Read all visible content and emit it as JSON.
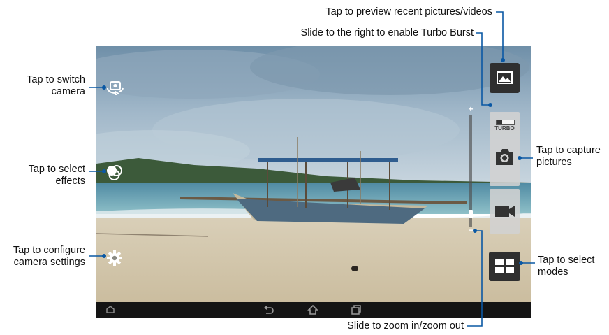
{
  "callouts": {
    "preview": "Tap to preview recent pictures/videos",
    "turbo": "Slide to the right to enable Turbo Burst",
    "switch_camera_1": "Tap to switch",
    "switch_camera_2": "camera",
    "effects_1": "Tap to select",
    "effects_2": "effects",
    "settings_1": "Tap to configure",
    "settings_2": "camera settings",
    "capture_1": "Tap to capture",
    "capture_2": "pictures",
    "modes_1": "Tap to select",
    "modes_2": "modes",
    "zoom": "Slide to zoom in/zoom out"
  },
  "camera_ui": {
    "turbo_label": "TURBO",
    "zoom_plus": "+",
    "zoom_minus": "−",
    "zoom_level": 0.08,
    "turbo_enabled": false
  },
  "icons": {
    "preview": "gallery-thumbnail-icon",
    "switch": "switch-camera-icon",
    "effects": "effects-icon",
    "settings": "gear-icon",
    "capture": "camera-shutter-icon",
    "video": "video-record-icon",
    "modes": "modes-grid-icon",
    "nav_home": "home-icon",
    "nav_back": "back-icon",
    "nav_recent": "recent-apps-icon"
  },
  "colors": {
    "callout_line": "#0a58a4",
    "button_dark": "#2f2f2f",
    "button_light": "#d2d2d2"
  }
}
